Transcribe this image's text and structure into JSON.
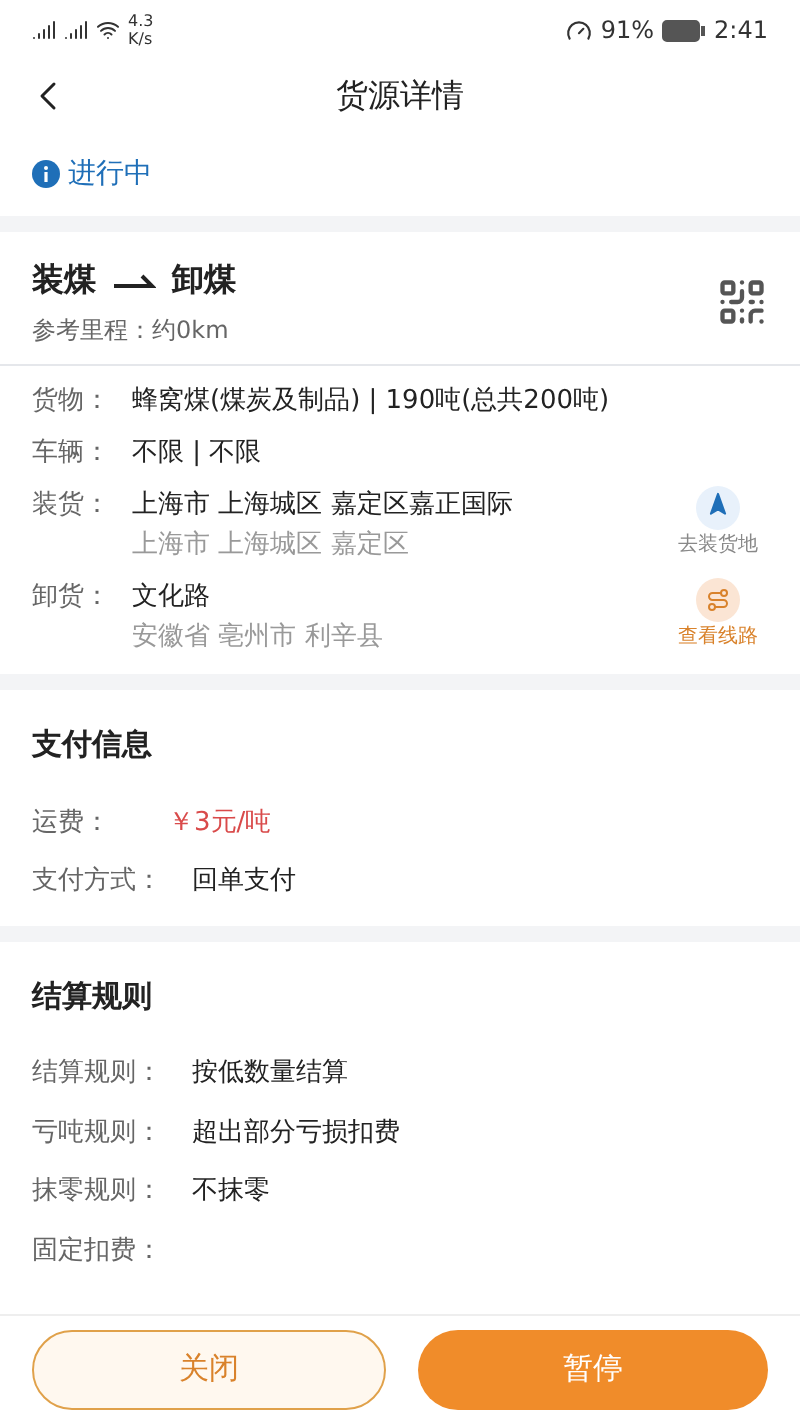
{
  "status_bar": {
    "net_speed": "4.3 K/s",
    "battery": "91%",
    "time": "2:41"
  },
  "header": {
    "title": "货源详情"
  },
  "progress": {
    "label": "进行中"
  },
  "route": {
    "title_from": "装煤",
    "title_to": "卸煤",
    "distance": "参考里程：约0km"
  },
  "details": [
    {
      "kind": "plain",
      "label": "货物：",
      "value": "蜂窝煤(煤炭及制品) | 190吨(总共200吨)"
    },
    {
      "kind": "plain",
      "label": "车辆：",
      "value": "不限 | 不限"
    },
    {
      "kind": "navigate",
      "label": "装货：",
      "value": "上海市 上海城区 嘉定区嘉正国际",
      "sub": "上海市 上海城区 嘉定区",
      "action": "去装货地"
    },
    {
      "kind": "route",
      "label": "卸货：",
      "value": "文化路",
      "sub": "安徽省 亳州市 利辛县",
      "action": "查看线路"
    }
  ],
  "payment": {
    "title": "支付信息",
    "rows": [
      {
        "label": "运费：",
        "value": "￥3元/吨",
        "highlight": true
      },
      {
        "label": "支付方式：",
        "value": "回单支付",
        "highlight": false
      }
    ]
  },
  "settlement": {
    "title": "结算规则",
    "rows": [
      {
        "label": "结算规则：",
        "value": "按低数量结算"
      },
      {
        "label": "亏吨规则：",
        "value": "超出部分亏损扣费"
      },
      {
        "label": "抹零规则：",
        "value": "不抹零"
      },
      {
        "label": "固定扣费："
      }
    ]
  },
  "buttons": [
    {
      "label": "关闭",
      "kind": "outline"
    },
    {
      "label": "暂停",
      "kind": "filled"
    }
  ]
}
